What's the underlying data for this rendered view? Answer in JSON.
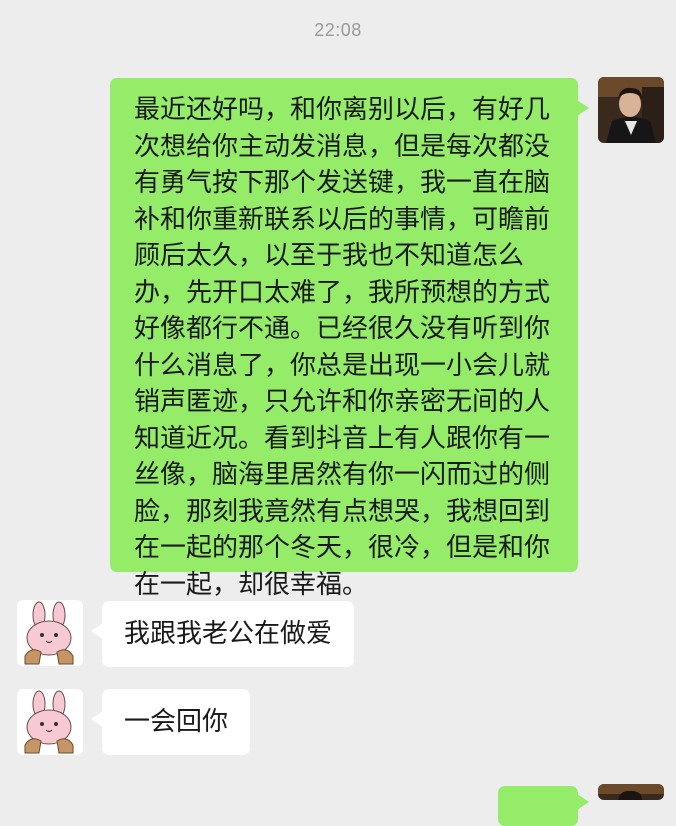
{
  "status": {
    "time": "22:08"
  },
  "colors": {
    "background": "#ededed",
    "sent_bubble": "#95ec69",
    "received_bubble": "#ffffff",
    "timestamp": "#9a9a9a"
  },
  "avatars": {
    "me": "man-in-suit-photo",
    "contact": "pink-bunny-sticker"
  },
  "messages": [
    {
      "sender": "me",
      "text": "最近还好吗，和你离别以后，有好几次想给你主动发消息，但是每次都没有勇气按下那个发送键，我一直在脑补和你重新联系以后的事情，可瞻前顾后太久，以至于我也不知道怎么办，先开口太难了，我所预想的方式好像都行不通。已经很久没有听到你什么消息了，你总是出现一小会儿就销声匿迹，只允许和你亲密无间的人知道近况。看到抖音上有人跟你有一丝像，脑海里居然有你一闪而过的侧脸，那刻我竟然有点想哭，我想回到在一起的那个冬天，很冷，但是和你在一起，却很幸福。"
    },
    {
      "sender": "contact",
      "text": "我跟我老公在做爱"
    },
    {
      "sender": "contact",
      "text": "一会回你"
    }
  ]
}
